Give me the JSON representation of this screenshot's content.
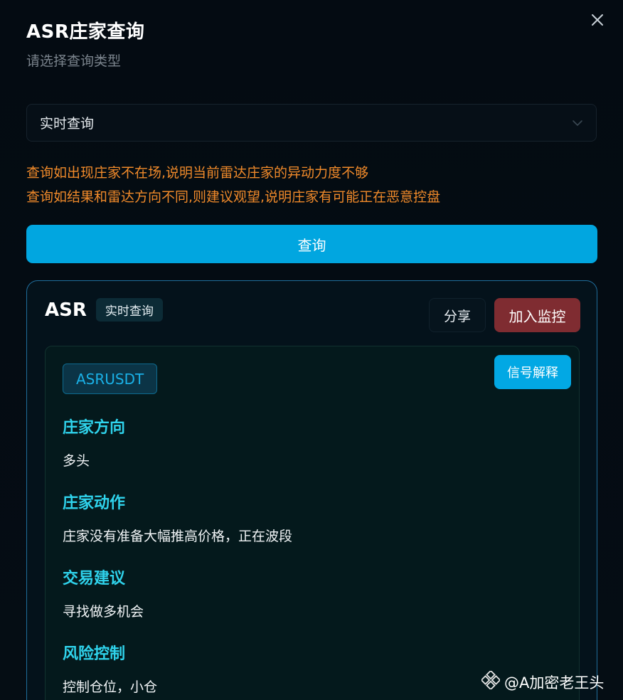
{
  "header": {
    "title": "ASR庄家查询",
    "subtitle": "请选择查询类型"
  },
  "select": {
    "value": "实时查询"
  },
  "warnings": [
    "查询如出现庄家不在场,说明当前雷达庄家的异动力度不够",
    "查询如结果和雷达方向不同,则建议观望,说明庄家有可能正在恶意控盘"
  ],
  "query_button": "查询",
  "result": {
    "symbol": "ASR",
    "mode_tag": "实时查询",
    "share_label": "分享",
    "monitor_label": "加入监控",
    "pair": "ASRUSDT",
    "signal_label": "信号解释",
    "sections": [
      {
        "title": "庄家方向",
        "value": "多头"
      },
      {
        "title": "庄家动作",
        "value": "庄家没有准备大幅推高价格，正在波段"
      },
      {
        "title": "交易建议",
        "value": "寻找做多机会"
      },
      {
        "title": "风险控制",
        "value": "控制仓位，小仓"
      }
    ]
  },
  "watermark": "@A加密老王头",
  "colors": {
    "accent": "#01a6e0",
    "warning": "#f08a2a",
    "section_title": "#2fd3ec",
    "monitor_button": "#7f2c31"
  },
  "icons": {
    "close": "close-icon",
    "chevron": "chevron-down-icon",
    "watermark_logo": "binance-logo-icon"
  }
}
